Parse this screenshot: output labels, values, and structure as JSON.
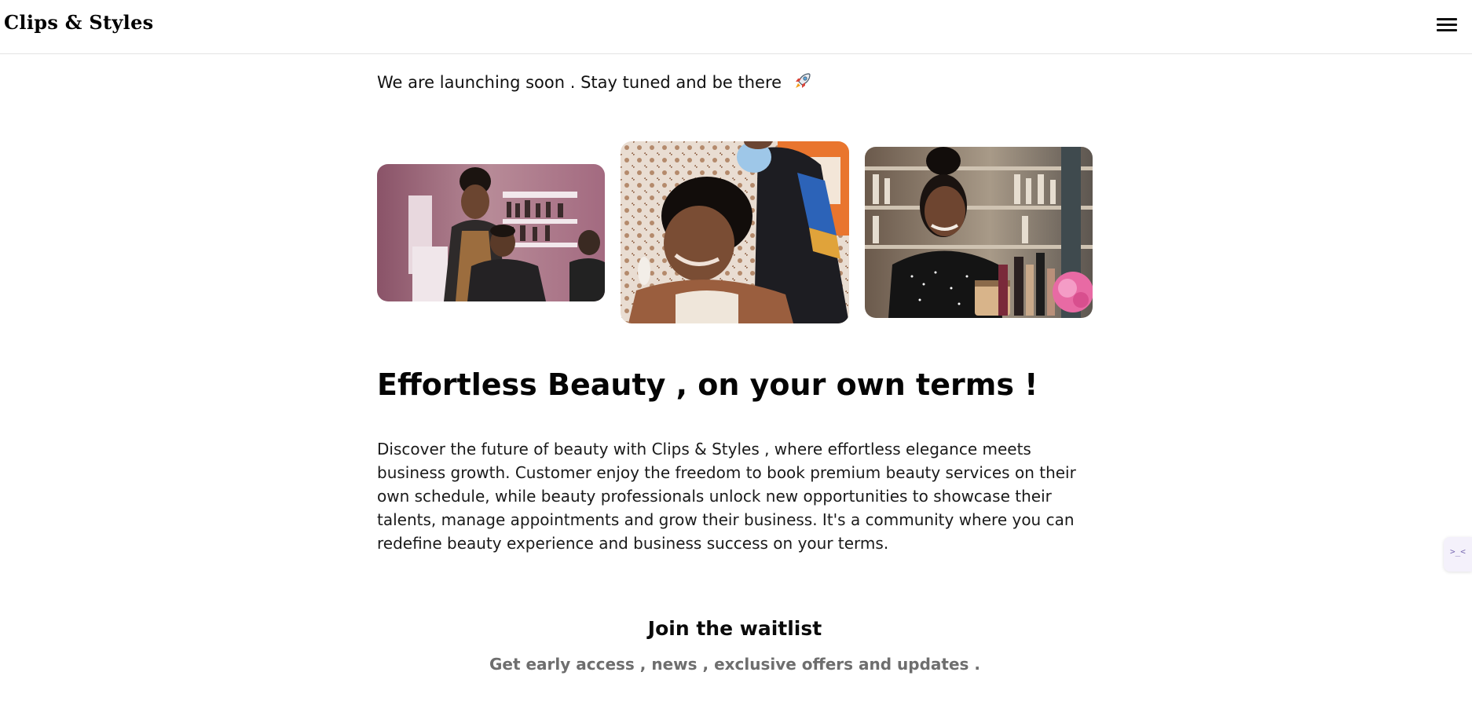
{
  "header": {
    "brand": "Clips & Styles",
    "menu_icon": "hamburger-menu-icon"
  },
  "announcement": {
    "text": "We are launching soon . Stay tuned and be there",
    "icon": "rocket-icon"
  },
  "gallery": {
    "images": [
      {
        "name": "salon-stylist-with-client-photo"
      },
      {
        "name": "client-getting-hair-styled-photo"
      },
      {
        "name": "beauty-products-stylist-photo"
      }
    ]
  },
  "hero": {
    "title": "Effortless Beauty , on your own terms !",
    "description": "Discover the future of beauty with Clips & Styles , where effortless elegance meets business growth. Customer enjoy the freedom to book premium beauty services on their own schedule, while beauty professionals unlock new opportunities to showcase their talents, manage appointments and grow their business. It's a community where you can redefine beauty experience and business success on your terms."
  },
  "waitlist": {
    "title": "Join the waitlist",
    "subtitle": "Get early access , news , exclusive offers and updates ."
  },
  "side_widget": {
    "icon": "collapse-arrows-icon",
    "glyph": ">_<"
  },
  "colors": {
    "text": "#111111",
    "muted": "#6e6e6e",
    "divider": "#e3e3e3"
  }
}
